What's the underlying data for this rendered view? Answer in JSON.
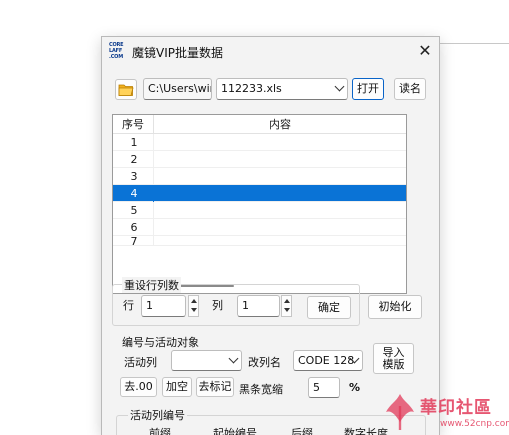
{
  "window": {
    "logo_text": [
      "CORE",
      "LAFF",
      ".COM"
    ],
    "title": "魔镜VIP批量数据",
    "close_glyph": "✕"
  },
  "toolbar": {
    "path_value": "C:\\Users\\win",
    "file_value": "112233.xls",
    "open_label": "打开",
    "readname_label": "读名"
  },
  "list": {
    "headers": {
      "index": "序号",
      "content": "内容"
    },
    "rows": [
      {
        "index": "1",
        "content": ""
      },
      {
        "index": "2",
        "content": ""
      },
      {
        "index": "3",
        "content": ""
      },
      {
        "index": "4",
        "content": ""
      },
      {
        "index": "5",
        "content": ""
      },
      {
        "index": "6",
        "content": ""
      },
      {
        "index": "7",
        "content": ""
      }
    ],
    "selected_row": "4"
  },
  "reset_group": {
    "title": "重设行列数",
    "row_label": "行",
    "row_value": "1",
    "col_label": "列",
    "col_value": "1",
    "confirm_label": "确定",
    "init_label": "初始化"
  },
  "numbering_group": {
    "title": "编号与活动对象",
    "active_col_label": "活动列",
    "active_col_value": "",
    "rename_label": "改列名",
    "rename_value": "CODE 128",
    "import_label_1": "导入",
    "import_label_2": "模版",
    "strip00_label": "去.00",
    "fill_empty_label": "加空",
    "strip_mark_label": "去标记",
    "bar_width_label": "黑条宽缩",
    "bar_width_value": "5",
    "percent": "%"
  },
  "active_number_group": {
    "title": "活动列编号",
    "prefix": "前缀",
    "start": "起始编号",
    "suffix": "后缀",
    "digits": "数字长度"
  },
  "watermark": {
    "text": "華印社區",
    "url": "www.52cnp.com"
  },
  "colors": {
    "selection": "#0a73d6",
    "accent_border": "#0a64c8",
    "folder": "#f2b01e",
    "watermark": "#e23a5a"
  }
}
